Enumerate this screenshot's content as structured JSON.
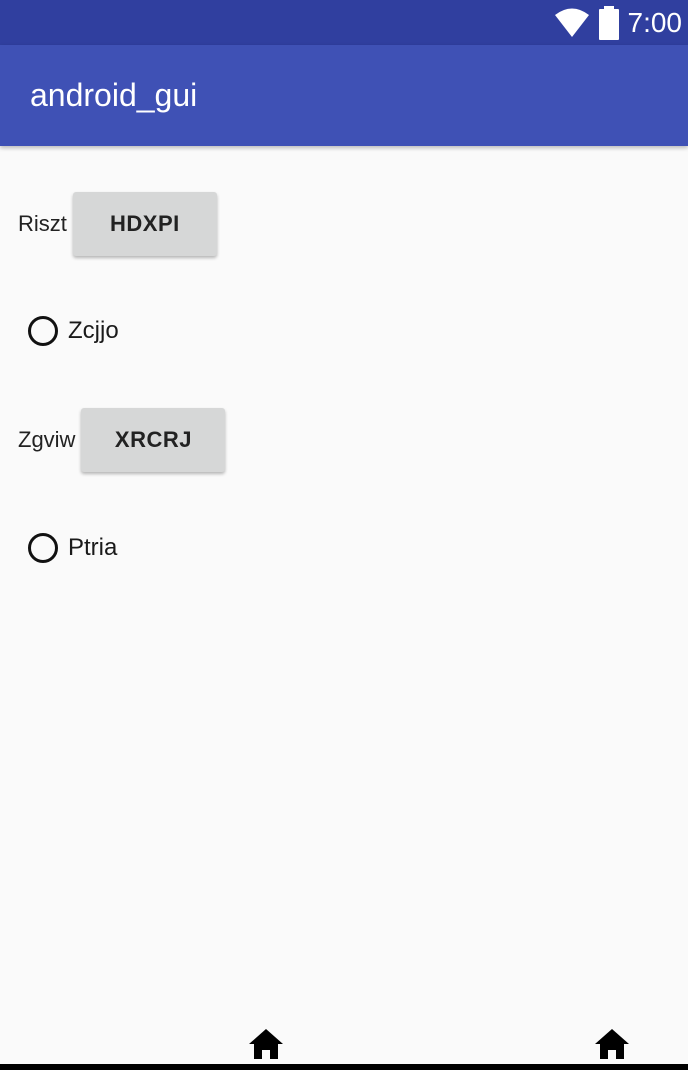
{
  "status_bar": {
    "time": "7:00",
    "icons": [
      "wifi-icon",
      "battery-icon"
    ],
    "color": "#303f9f"
  },
  "app_bar": {
    "title": "android_gui",
    "color": "#3f51b5"
  },
  "rows": [
    {
      "label": "Riszt",
      "button": "HDXPI"
    },
    {
      "label": "Zgviw",
      "button": "XRCRJ"
    }
  ],
  "radios": [
    {
      "label": "Zcjjo",
      "checked": false
    },
    {
      "label": "Ptria",
      "checked": false
    }
  ],
  "nav_bar": {
    "icons": [
      "home-icon",
      "home-icon"
    ]
  }
}
